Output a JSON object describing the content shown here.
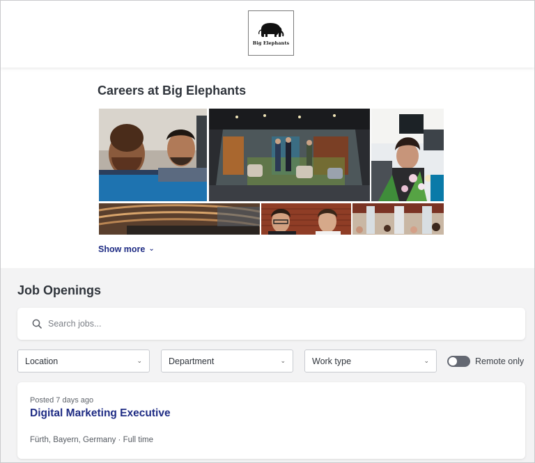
{
  "header": {
    "logo_text": "Big Elephants"
  },
  "hero": {
    "title": "Careers at Big Elephants",
    "show_more_label": "Show more",
    "show_more_icon": "chevron-down-icon"
  },
  "openings": {
    "title": "Job Openings",
    "search": {
      "placeholder": "Search jobs...",
      "value": "",
      "icon": "search-icon"
    },
    "filters": [
      {
        "label": "Location",
        "icon": "chevron-down-icon"
      },
      {
        "label": "Department",
        "icon": "chevron-down-icon"
      },
      {
        "label": "Work type",
        "icon": "chevron-down-icon"
      }
    ],
    "remote_only": {
      "label": "Remote only",
      "enabled": false
    },
    "jobs": [
      {
        "posted": "Posted 7 days ago",
        "title": "Digital Marketing Executive",
        "meta": "Fürth, Bayern, Germany · Full time"
      }
    ]
  },
  "colors": {
    "link": "#1f2c84",
    "page_bg": "#f3f3f4",
    "toggle_off": "#646872"
  }
}
